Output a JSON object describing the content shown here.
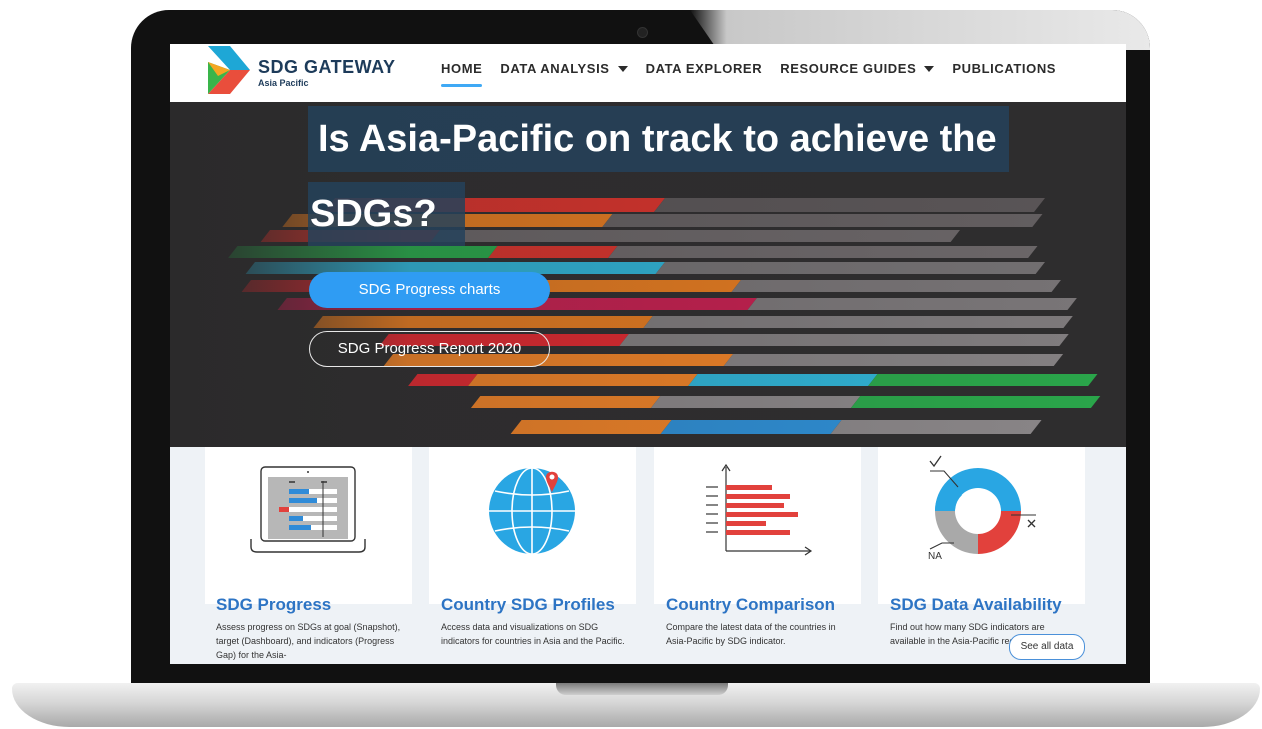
{
  "header": {
    "logo_title": "SDG GATEWAY",
    "logo_subtitle": "Asia Pacific",
    "nav": [
      {
        "label": "HOME",
        "active": true,
        "dropdown": false
      },
      {
        "label": "DATA ANALYSIS",
        "active": false,
        "dropdown": true
      },
      {
        "label": "DATA EXPLORER",
        "active": false,
        "dropdown": false
      },
      {
        "label": "RESOURCE GUIDES",
        "active": false,
        "dropdown": true
      },
      {
        "label": "PUBLICATIONS",
        "active": false,
        "dropdown": false
      }
    ]
  },
  "hero": {
    "title_line1": "Is Asia-Pacific on track to achieve the",
    "title_line2": "SDGs?",
    "primary_button": "SDG Progress charts",
    "secondary_button": "SDG Progress Report 2020"
  },
  "cards": [
    {
      "title": "SDG Progress",
      "description": "Assess progress on SDGs at goal (Snapshot), target (Dashboard), and indicators (Progress Gap) for the Asia-",
      "icon": "laptop-bar-chart-icon"
    },
    {
      "title": "Country SDG Profiles",
      "description": "Access data and visualizations on SDG indicators for countries in Asia and the Pacific.",
      "icon": "globe-pin-icon"
    },
    {
      "title": "Country Comparison",
      "description": "Compare the latest data of the countries in Asia-Pacific by SDG indicator.",
      "icon": "horizontal-bar-chart-icon"
    },
    {
      "title": "SDG Data Availability",
      "description": "Find out how many SDG indicators are available in the Asia-Pacific region.",
      "icon": "donut-chart-icon"
    }
  ],
  "see_all_label": "See all data",
  "donut_labels": {
    "na": "NA"
  },
  "colors": {
    "accent": "#2f9cf3",
    "brand_dark": "#1d3b5a",
    "card_title": "#2d74c4",
    "hero_bg": "#2b2a2b"
  }
}
